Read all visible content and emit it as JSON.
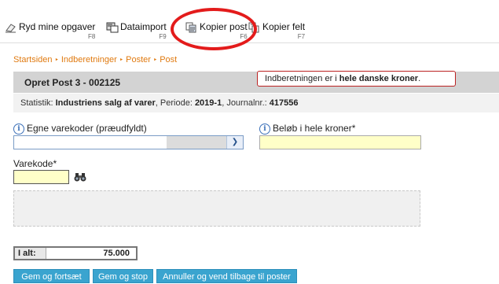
{
  "toolbar": {
    "items": [
      {
        "label": "Ryd mine opgaver",
        "key": "F8",
        "icon": "eraser-icon"
      },
      {
        "label": "Dataimport",
        "key": "F9",
        "icon": "data-import-icon"
      },
      {
        "label": "Kopier post",
        "key": "F6",
        "icon": "copy-post-icon"
      },
      {
        "label": "Kopier felt",
        "key": "F7",
        "icon": "copy-field-icon"
      }
    ],
    "highlight_color": "#e31b1b"
  },
  "breadcrumb": [
    "Startsiden",
    "Indberetninger",
    "Poster",
    "Post"
  ],
  "header": {
    "title": "Opret Post 3 - 002125",
    "note_prefix": "Indberetningen er i ",
    "note_bold": "hele danske kroner",
    "note_suffix": "."
  },
  "stat": {
    "l1": "Statistik: ",
    "v1": "Industriens salg af varer",
    "l2": ", Periode: ",
    "v2": "2019-1",
    "l3": ", Journalnr.: ",
    "v3": "417556"
  },
  "form": {
    "egne_label": "Egne varekoder (præudfyldt)",
    "belob_label": "Beløb i hele kroner*",
    "varekode_label": "Varekode*",
    "egne_value": "",
    "belob_value": "",
    "varekode_value": ""
  },
  "total": {
    "label": "I alt:",
    "value": "75.000"
  },
  "buttons": {
    "gem_fortsaet": "Gem og fortsæt",
    "gem_stop": "Gem og stop",
    "annuller": "Annuller og vend tilbage til poster"
  },
  "colors": {
    "accent": "#e07a10",
    "button": "#3aa4cf",
    "input_yellow": "#ffffc8"
  }
}
